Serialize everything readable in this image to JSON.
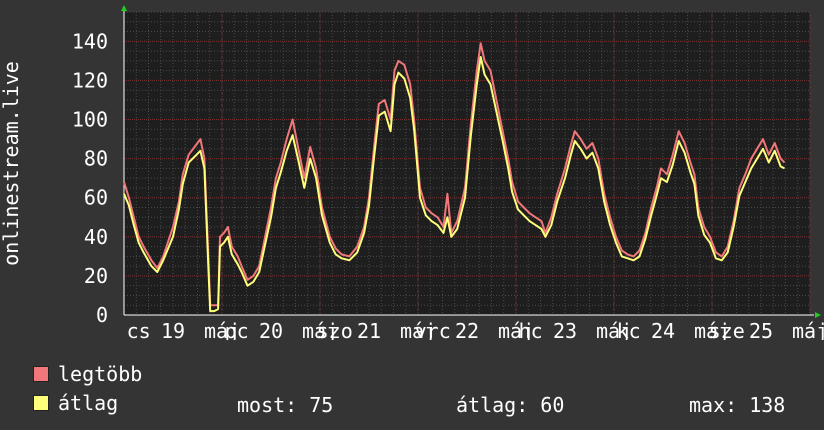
{
  "chart_data": {
    "type": "line",
    "ylabel": "onlinestream.live",
    "ylim": [
      0,
      155
    ],
    "yticks": [
      0,
      20,
      40,
      60,
      80,
      100,
      120,
      140
    ],
    "grid": true,
    "legend_placement": "bottom-left",
    "x_tick_labels": [
      {
        "t": 0.15,
        "label": "cs"
      },
      {
        "t": 0.5,
        "label": "19"
      },
      {
        "t": 1.0,
        "label": "máj"
      },
      {
        "t": 1.15,
        "label": "pc"
      },
      {
        "t": 1.5,
        "label": "20"
      },
      {
        "t": 2.0,
        "label": "máj"
      },
      {
        "t": 2.15,
        "label": "szo"
      },
      {
        "t": 2.5,
        "label": "21"
      },
      {
        "t": 3.0,
        "label": "máj"
      },
      {
        "t": 3.15,
        "label": "vrc"
      },
      {
        "t": 3.5,
        "label": "22"
      },
      {
        "t": 4.0,
        "label": "máj"
      },
      {
        "t": 4.15,
        "label": "hc"
      },
      {
        "t": 4.5,
        "label": "23"
      },
      {
        "t": 5.0,
        "label": "máj"
      },
      {
        "t": 5.15,
        "label": "kc"
      },
      {
        "t": 5.5,
        "label": "24"
      },
      {
        "t": 6.0,
        "label": "máj"
      },
      {
        "t": 6.15,
        "label": "sze"
      },
      {
        "t": 6.5,
        "label": "25"
      },
      {
        "t": 7.0,
        "label": "máj"
      }
    ],
    "xlim": [
      0,
      7.0
    ],
    "series": [
      {
        "name": "legtöbb",
        "color": "#f2777a",
        "points": [
          [
            0,
            68
          ],
          [
            0.05,
            60
          ],
          [
            0.1,
            50
          ],
          [
            0.15,
            40
          ],
          [
            0.2,
            35
          ],
          [
            0.28,
            28
          ],
          [
            0.34,
            24
          ],
          [
            0.4,
            30
          ],
          [
            0.5,
            45
          ],
          [
            0.56,
            58
          ],
          [
            0.6,
            72
          ],
          [
            0.66,
            82
          ],
          [
            0.72,
            86
          ],
          [
            0.78,
            90
          ],
          [
            0.82,
            80
          ],
          [
            0.86,
            30
          ],
          [
            0.88,
            5
          ],
          [
            0.92,
            5
          ],
          [
            0.96,
            5
          ],
          [
            0.98,
            40
          ],
          [
            1.02,
            42
          ],
          [
            1.06,
            45
          ],
          [
            1.1,
            35
          ],
          [
            1.16,
            30
          ],
          [
            1.2,
            25
          ],
          [
            1.26,
            18
          ],
          [
            1.32,
            20
          ],
          [
            1.38,
            25
          ],
          [
            1.44,
            40
          ],
          [
            1.5,
            55
          ],
          [
            1.55,
            70
          ],
          [
            1.6,
            78
          ],
          [
            1.66,
            90
          ],
          [
            1.72,
            100
          ],
          [
            1.78,
            85
          ],
          [
            1.84,
            70
          ],
          [
            1.9,
            86
          ],
          [
            1.96,
            75
          ],
          [
            2.02,
            55
          ],
          [
            2.1,
            40
          ],
          [
            2.16,
            34
          ],
          [
            2.22,
            31
          ],
          [
            2.3,
            30
          ],
          [
            2.38,
            35
          ],
          [
            2.45,
            45
          ],
          [
            2.5,
            60
          ],
          [
            2.55,
            85
          ],
          [
            2.6,
            108
          ],
          [
            2.66,
            110
          ],
          [
            2.72,
            100
          ],
          [
            2.76,
            125
          ],
          [
            2.8,
            130
          ],
          [
            2.86,
            128
          ],
          [
            2.92,
            118
          ],
          [
            2.96,
            100
          ],
          [
            3.02,
            65
          ],
          [
            3.08,
            55
          ],
          [
            3.14,
            52
          ],
          [
            3.2,
            50
          ],
          [
            3.26,
            45
          ],
          [
            3.3,
            62
          ],
          [
            3.34,
            42
          ],
          [
            3.4,
            48
          ],
          [
            3.48,
            65
          ],
          [
            3.54,
            98
          ],
          [
            3.6,
            125
          ],
          [
            3.64,
            139
          ],
          [
            3.68,
            130
          ],
          [
            3.74,
            125
          ],
          [
            3.8,
            110
          ],
          [
            3.86,
            95
          ],
          [
            3.92,
            80
          ],
          [
            3.96,
            68
          ],
          [
            4.02,
            58
          ],
          [
            4.08,
            55
          ],
          [
            4.14,
            52
          ],
          [
            4.2,
            50
          ],
          [
            4.26,
            48
          ],
          [
            4.3,
            42
          ],
          [
            4.36,
            50
          ],
          [
            4.42,
            62
          ],
          [
            4.5,
            75
          ],
          [
            4.56,
            87
          ],
          [
            4.6,
            94
          ],
          [
            4.66,
            90
          ],
          [
            4.72,
            85
          ],
          [
            4.78,
            88
          ],
          [
            4.84,
            80
          ],
          [
            4.9,
            62
          ],
          [
            4.96,
            50
          ],
          [
            5.02,
            40
          ],
          [
            5.08,
            33
          ],
          [
            5.14,
            31
          ],
          [
            5.2,
            30
          ],
          [
            5.26,
            33
          ],
          [
            5.32,
            42
          ],
          [
            5.38,
            55
          ],
          [
            5.44,
            66
          ],
          [
            5.48,
            75
          ],
          [
            5.54,
            72
          ],
          [
            5.6,
            82
          ],
          [
            5.66,
            94
          ],
          [
            5.72,
            88
          ],
          [
            5.78,
            78
          ],
          [
            5.82,
            72
          ],
          [
            5.86,
            55
          ],
          [
            5.92,
            45
          ],
          [
            5.98,
            40
          ],
          [
            6.04,
            32
          ],
          [
            6.1,
            30
          ],
          [
            6.16,
            35
          ],
          [
            6.22,
            48
          ],
          [
            6.28,
            65
          ],
          [
            6.34,
            72
          ],
          [
            6.4,
            80
          ],
          [
            6.46,
            85
          ],
          [
            6.52,
            90
          ],
          [
            6.58,
            82
          ],
          [
            6.64,
            88
          ],
          [
            6.7,
            80
          ],
          [
            6.74,
            78
          ]
        ]
      },
      {
        "name": "átlag",
        "color": "#ffff7a",
        "points": [
          [
            0,
            62
          ],
          [
            0.05,
            56
          ],
          [
            0.1,
            46
          ],
          [
            0.15,
            37
          ],
          [
            0.2,
            32
          ],
          [
            0.28,
            25
          ],
          [
            0.34,
            22
          ],
          [
            0.4,
            28
          ],
          [
            0.5,
            40
          ],
          [
            0.56,
            54
          ],
          [
            0.6,
            67
          ],
          [
            0.66,
            78
          ],
          [
            0.72,
            81
          ],
          [
            0.78,
            84
          ],
          [
            0.82,
            75
          ],
          [
            0.86,
            25
          ],
          [
            0.88,
            2
          ],
          [
            0.92,
            2
          ],
          [
            0.96,
            3
          ],
          [
            0.98,
            35
          ],
          [
            1.02,
            37
          ],
          [
            1.06,
            40
          ],
          [
            1.1,
            31
          ],
          [
            1.16,
            26
          ],
          [
            1.2,
            22
          ],
          [
            1.26,
            15
          ],
          [
            1.32,
            17
          ],
          [
            1.38,
            22
          ],
          [
            1.44,
            36
          ],
          [
            1.5,
            50
          ],
          [
            1.55,
            65
          ],
          [
            1.6,
            73
          ],
          [
            1.66,
            84
          ],
          [
            1.72,
            92
          ],
          [
            1.78,
            79
          ],
          [
            1.84,
            65
          ],
          [
            1.9,
            80
          ],
          [
            1.96,
            70
          ],
          [
            2.02,
            51
          ],
          [
            2.1,
            37
          ],
          [
            2.16,
            31
          ],
          [
            2.22,
            29
          ],
          [
            2.3,
            28
          ],
          [
            2.38,
            32
          ],
          [
            2.45,
            42
          ],
          [
            2.5,
            56
          ],
          [
            2.55,
            80
          ],
          [
            2.6,
            102
          ],
          [
            2.66,
            104
          ],
          [
            2.72,
            94
          ],
          [
            2.76,
            118
          ],
          [
            2.8,
            124
          ],
          [
            2.86,
            121
          ],
          [
            2.92,
            111
          ],
          [
            2.96,
            95
          ],
          [
            3.02,
            60
          ],
          [
            3.08,
            51
          ],
          [
            3.14,
            48
          ],
          [
            3.2,
            46
          ],
          [
            3.26,
            42
          ],
          [
            3.3,
            50
          ],
          [
            3.34,
            40
          ],
          [
            3.4,
            44
          ],
          [
            3.48,
            60
          ],
          [
            3.54,
            92
          ],
          [
            3.6,
            118
          ],
          [
            3.64,
            132
          ],
          [
            3.68,
            123
          ],
          [
            3.74,
            118
          ],
          [
            3.8,
            104
          ],
          [
            3.86,
            90
          ],
          [
            3.92,
            75
          ],
          [
            3.96,
            63
          ],
          [
            4.02,
            54
          ],
          [
            4.08,
            51
          ],
          [
            4.14,
            48
          ],
          [
            4.2,
            46
          ],
          [
            4.26,
            44
          ],
          [
            4.3,
            40
          ],
          [
            4.36,
            46
          ],
          [
            4.42,
            58
          ],
          [
            4.5,
            70
          ],
          [
            4.56,
            82
          ],
          [
            4.6,
            89
          ],
          [
            4.66,
            85
          ],
          [
            4.72,
            80
          ],
          [
            4.78,
            83
          ],
          [
            4.84,
            75
          ],
          [
            4.9,
            58
          ],
          [
            4.96,
            46
          ],
          [
            5.02,
            37
          ],
          [
            5.08,
            30
          ],
          [
            5.14,
            29
          ],
          [
            5.2,
            28
          ],
          [
            5.26,
            30
          ],
          [
            5.32,
            39
          ],
          [
            5.38,
            51
          ],
          [
            5.44,
            62
          ],
          [
            5.48,
            70
          ],
          [
            5.54,
            68
          ],
          [
            5.6,
            77
          ],
          [
            5.66,
            89
          ],
          [
            5.72,
            83
          ],
          [
            5.78,
            73
          ],
          [
            5.82,
            67
          ],
          [
            5.86,
            51
          ],
          [
            5.92,
            41
          ],
          [
            5.98,
            37
          ],
          [
            6.04,
            29
          ],
          [
            6.1,
            28
          ],
          [
            6.16,
            32
          ],
          [
            6.22,
            45
          ],
          [
            6.28,
            61
          ],
          [
            6.34,
            68
          ],
          [
            6.4,
            75
          ],
          [
            6.46,
            80
          ],
          [
            6.52,
            85
          ],
          [
            6.58,
            78
          ],
          [
            6.64,
            84
          ],
          [
            6.7,
            76
          ],
          [
            6.74,
            75
          ]
        ]
      }
    ]
  },
  "legend": {
    "items": [
      {
        "label": "legtöbb",
        "color": "#f2777a"
      },
      {
        "label": "átlag",
        "color": "#ffff7a"
      }
    ],
    "now_label": "most: 75",
    "avg_label": "átlag: 60",
    "max_label": "max: 138"
  }
}
